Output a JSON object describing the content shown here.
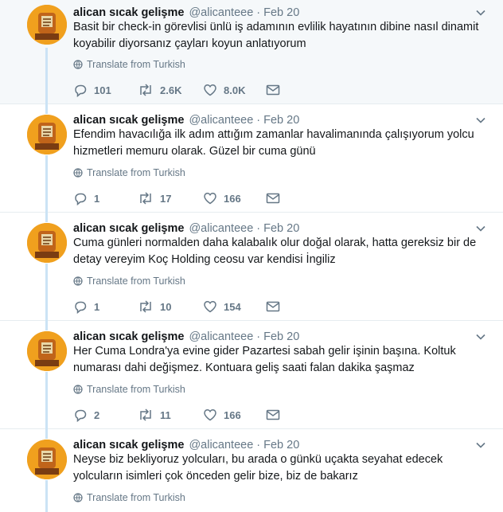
{
  "tweets": [
    {
      "name": "alican sıcak gelişme",
      "handle": "@alicanteee",
      "separator": "·",
      "date": "Feb 20",
      "text": "Basit bir check-in görevlisi ünlü iş adamının evlilik hayatının dibine nasıl dinamit koyabilir diyorsanız çayları koyun anlatıyorum",
      "translate": "Translate from Turkish",
      "replies": "101",
      "retweets": "2.6K",
      "likes": "8.0K"
    },
    {
      "name": "alican sıcak gelişme",
      "handle": "@alicanteee",
      "separator": "·",
      "date": "Feb 20",
      "text": "Efendim havacılığa ilk adım attığım zamanlar havalimanında çalışıyorum yolcu hizmetleri memuru olarak. Güzel bir cuma günü",
      "translate": "Translate from Turkish",
      "replies": "1",
      "retweets": "17",
      "likes": "166"
    },
    {
      "name": "alican sıcak gelişme",
      "handle": "@alicanteee",
      "separator": "·",
      "date": "Feb 20",
      "text": "Cuma günleri normalden daha kalabalık olur doğal olarak, hatta gereksiz bir de detay vereyim Koç Holding ceosu var kendisi İngiliz",
      "translate": "Translate from Turkish",
      "replies": "1",
      "retweets": "10",
      "likes": "154"
    },
    {
      "name": "alican sıcak gelişme",
      "handle": "@alicanteee",
      "separator": "·",
      "date": "Feb 20",
      "text": "Her Cuma Londra'ya evine gider Pazartesi sabah gelir işinin başına. Koltuk numarası dahi değişmez. Kontuara geliş saati falan dakika şaşmaz",
      "translate": "Translate from Turkish",
      "replies": "2",
      "retweets": "11",
      "likes": "166"
    },
    {
      "name": "alican sıcak gelişme",
      "handle": "@alicanteee",
      "separator": "·",
      "date": "Feb 20",
      "text": "Neyse biz bekliyoruz yolcuları, bu arada o günkü uçakta seyahat edecek yolcuların isimleri çok önceden gelir bize, biz de bakarız",
      "translate": "Translate from Turkish"
    }
  ],
  "colors": {
    "text": "#14171a",
    "muted": "#657786",
    "thread_line": "#cbe3f5",
    "highlight_bg": "#f5f8fa",
    "avatar": "#f0a01e"
  },
  "icons": [
    "caret-down-icon",
    "globe-icon",
    "reply-icon",
    "retweet-icon",
    "like-icon",
    "dm-icon"
  ]
}
